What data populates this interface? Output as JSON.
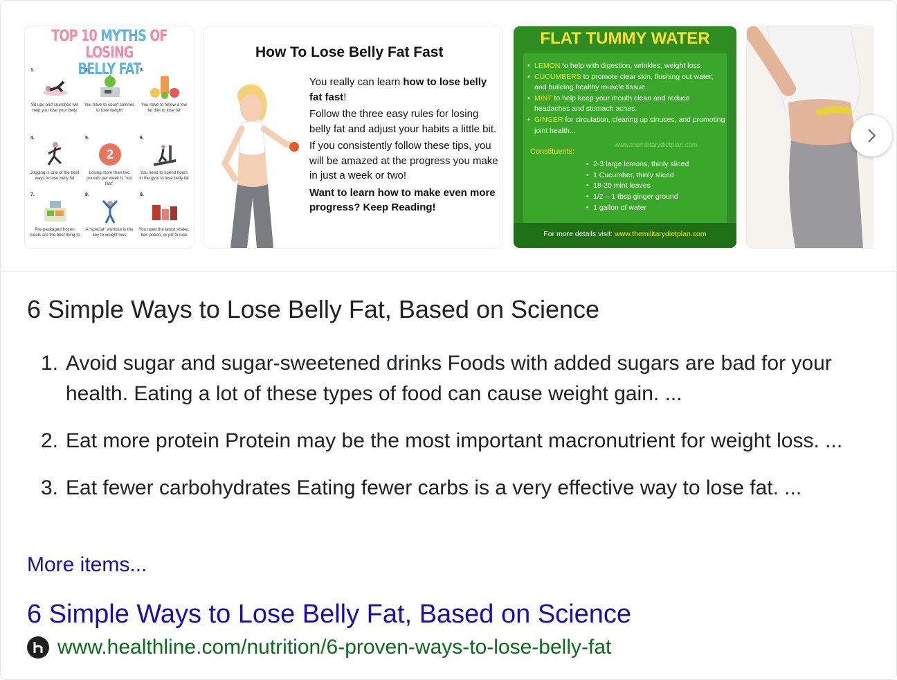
{
  "carousel": {
    "myths": {
      "title_line1_a": "TOP 10 ",
      "title_line1_b": "MYTHS",
      "title_line1_c": " OF LOSING",
      "title_line2": "BELLY FAT",
      "cells": [
        {
          "num": "1.",
          "caption": "Sit ups and crunches will help you lose your belly"
        },
        {
          "num": "2.",
          "caption": "You have to count calories to lose weight"
        },
        {
          "num": "3.",
          "caption": "You have to follow a low fat diet to lose fat"
        },
        {
          "num": "4.",
          "caption": "Jogging is one of the best ways to lose belly fat"
        },
        {
          "num": "5.",
          "caption": "Losing more than two pounds per week is \"too fast\""
        },
        {
          "num": "6.",
          "caption": "You need to spend hours in the gym to lose belly fat"
        },
        {
          "num": "7.",
          "caption": "Pre-packaged frozen meals are the best thing to"
        },
        {
          "num": "8.",
          "caption": "A \"special\" workout is the key to weight loss"
        },
        {
          "num": "9.",
          "caption": "You need the latest shake, bar, potion, or pill to lose"
        }
      ]
    },
    "belly": {
      "title": "How To Lose Belly Fat Fast",
      "p1_a": "You really can learn ",
      "p1_b": "how to lose belly fat fast",
      "p1_c": "!",
      "p2": "Follow the three easy rules for losing belly fat and adjust your habits a little bit.",
      "p3": "If you consistently follow these tips, you will be amazed at the progress you make in just a week or two!",
      "p4": "Want to learn how to make even more progress?  Keep Reading!"
    },
    "water": {
      "title": "FLAT TUMMY WATER",
      "items": [
        {
          "kw": "LEMON",
          "text": " to help with digestion, wrinkles, weight loss."
        },
        {
          "kw": "CUCUMBERS",
          "text": " to promote clear skin, flushing out water, and building healthy muscle tissue."
        },
        {
          "kw": "MINT",
          "text": " to help keep your mouth clean and reduce headaches and stomach aches."
        },
        {
          "kw": "GINGER",
          "text": " for circulation, clearing up sinuses, and promoting joint health..."
        }
      ],
      "watermark": "www.themilitarydietplan.com",
      "constituents_label": "Constituents:",
      "ingredients": [
        "2-3 large lemons, thinly sliced",
        "1 Cucumber, thinly sliced",
        "18-20 mint leaves",
        "1/2 – 1 tbsp ginger ground",
        "1 gallon of water"
      ],
      "footer_label": "For more details visit: ",
      "footer_url": "www.themilitarydietplan.com"
    },
    "next_icon": "chevron-right-icon"
  },
  "result": {
    "heading": "6 Simple Ways to Lose Belly Fat, Based on Science",
    "items": [
      {
        "num": "1.",
        "text": "Avoid sugar and sugar-sweetened drinks Foods with added sugars are bad for your health. Eating a lot of these types of food can cause weight gain. ..."
      },
      {
        "num": "2.",
        "text": "Eat more protein Protein may be the most important macronutrient for weight loss. ..."
      },
      {
        "num": "3.",
        "text": "Eat fewer carbohydrates Eating fewer carbs is a very effective way to lose fat. ..."
      }
    ],
    "more_label": "More items...",
    "link_title": "6 Simple Ways to Lose Belly Fat, Based on Science",
    "source_url": "www.healthline.com/nutrition/6-proven-ways-to-lose-belly-fat",
    "favicon": "healthline-h-icon"
  },
  "colors": {
    "link": "#1a0dab",
    "url": "#0b6b1c",
    "water_bg": "#2f8c23",
    "water_accent": "#f5e233"
  }
}
